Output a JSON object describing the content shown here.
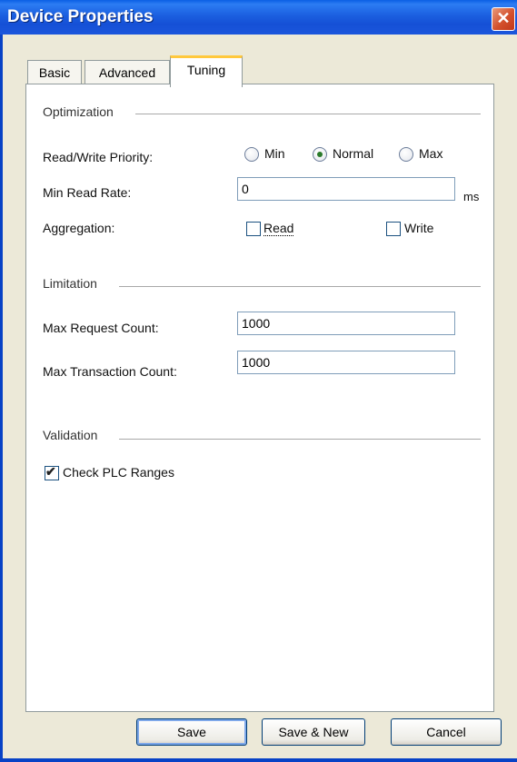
{
  "window": {
    "title": "Device Properties",
    "close_glyph": "✕"
  },
  "tabs": [
    {
      "label": "Basic"
    },
    {
      "label": "Advanced"
    },
    {
      "label": "Tuning"
    }
  ],
  "optimization": {
    "section_label": "Optimization",
    "priority_label": "Read/Write Priority:",
    "priority_options": [
      "Min",
      "Normal",
      "Max"
    ],
    "priority_selected": "Normal",
    "min_read_rate_label": "Min Read Rate:",
    "min_read_rate_value": "0",
    "min_read_rate_unit": "ms",
    "aggregation_label": "Aggregation:",
    "aggregation_read_label": "Read",
    "aggregation_read_checked": false,
    "aggregation_write_label": "Write",
    "aggregation_write_checked": false
  },
  "limitation": {
    "section_label": "Limitation",
    "max_request_label": "Max Request Count:",
    "max_request_value": "1000",
    "max_transaction_label": "Max Transaction Count:",
    "max_transaction_value": "1000"
  },
  "validation": {
    "section_label": "Validation",
    "check_plc_label": "Check PLC Ranges",
    "check_plc_checked": true
  },
  "buttons": {
    "save": "Save",
    "save_new": "Save & New",
    "cancel": "Cancel"
  }
}
